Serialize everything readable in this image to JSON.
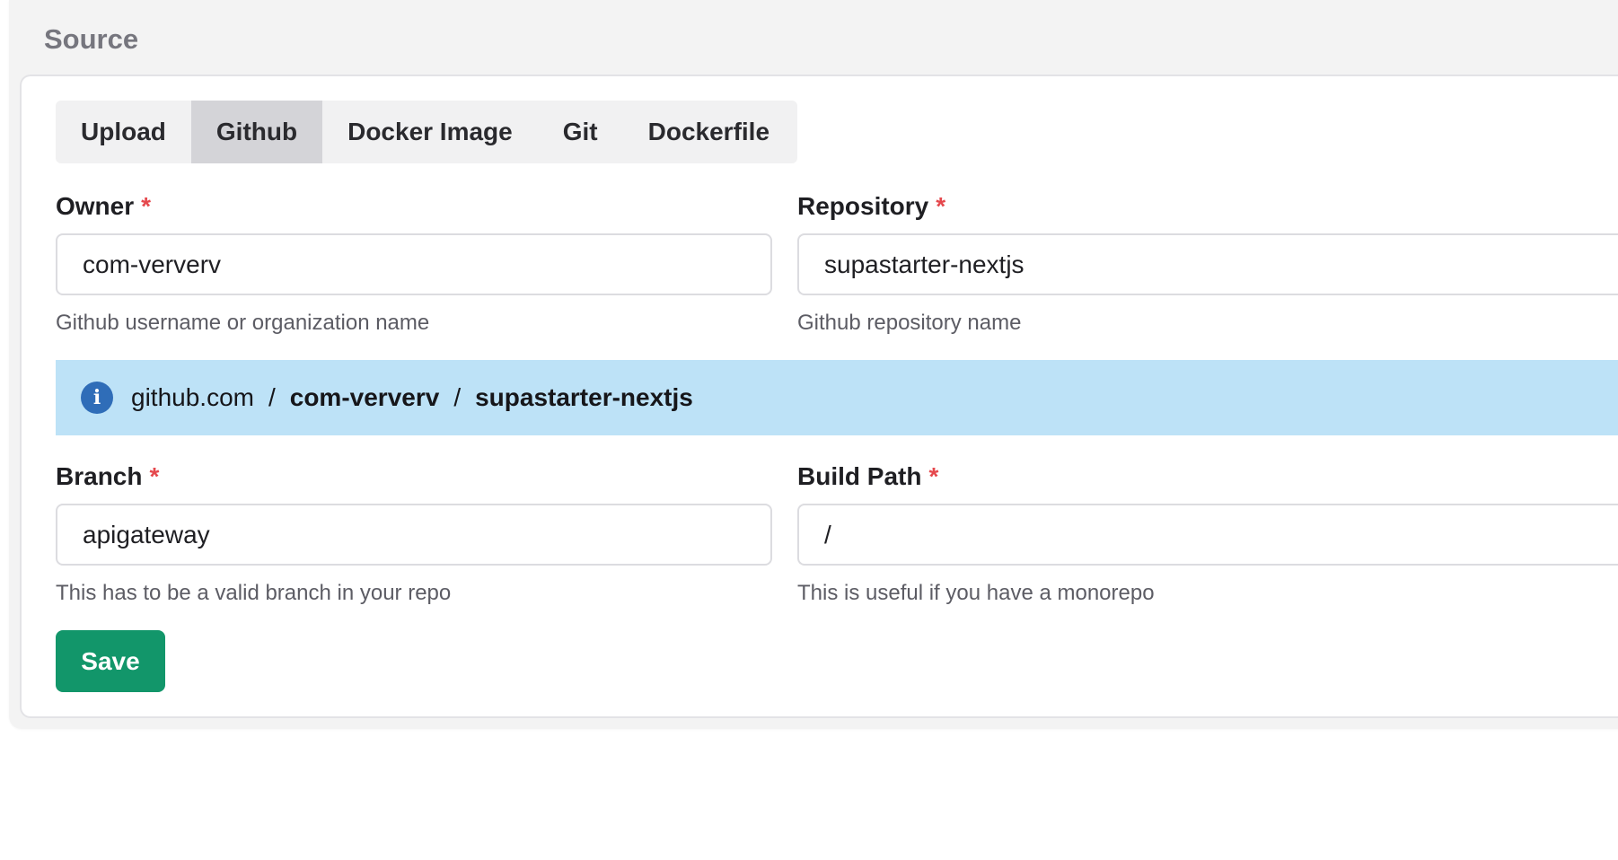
{
  "section": {
    "title": "Source"
  },
  "tabs": [
    {
      "label": "Upload",
      "active": false
    },
    {
      "label": "Github",
      "active": true
    },
    {
      "label": "Docker Image",
      "active": false
    },
    {
      "label": "Git",
      "active": false
    },
    {
      "label": "Dockerfile",
      "active": false
    }
  ],
  "owner": {
    "label": "Owner",
    "required": "*",
    "value": "com-ververv",
    "hint": "Github username or organization name"
  },
  "repository": {
    "label": "Repository",
    "required": "*",
    "value": "supastarter-nextjs",
    "hint": "Github repository name"
  },
  "info": {
    "icon": "info-icon",
    "host": "github.com",
    "separator": "/",
    "owner": "com-ververv",
    "repo": "supastarter-nextjs"
  },
  "branch": {
    "label": "Branch",
    "required": "*",
    "value": "apigateway",
    "hint": "This has to be a valid branch in your repo"
  },
  "build_path": {
    "label": "Build Path",
    "required": "*",
    "value": "/",
    "hint": "This is useful if you have a monorepo"
  },
  "save_label": "Save",
  "colors": {
    "accent": "#12966a",
    "required": "#e5484d",
    "info_bg": "#bde2f7",
    "info_icon": "#2f6db8"
  }
}
